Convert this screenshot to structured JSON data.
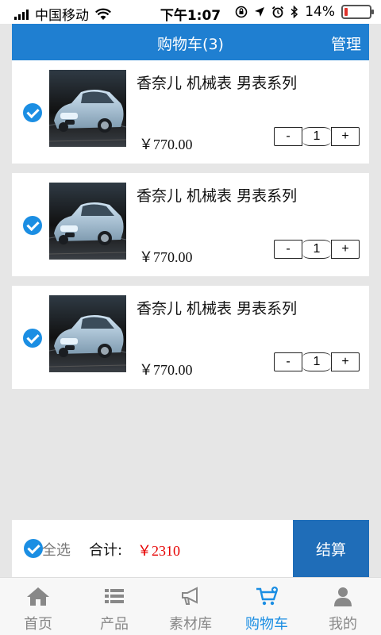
{
  "status_bar": {
    "carrier": "中国移动",
    "time": "下午1:07",
    "battery": "14%",
    "battery_level": 0.14
  },
  "header": {
    "title": "购物车(3)",
    "manage_label": "管理"
  },
  "cart": {
    "items": [
      {
        "name": "香奈儿 机械表 男表系列",
        "price": "￥770.00",
        "quantity": "1",
        "selected": true
      },
      {
        "name": "香奈儿 机械表 男表系列",
        "price": "￥770.00",
        "quantity": "1",
        "selected": true
      },
      {
        "name": "香奈儿 机械表 男表系列",
        "price": "￥770.00",
        "quantity": "1",
        "selected": true
      }
    ],
    "minus_label": "-",
    "plus_label": "+"
  },
  "footer": {
    "select_all_label": "全选",
    "total_label": "合计:",
    "total_value": "￥2310",
    "checkout_label": "结算"
  },
  "tab_bar": {
    "tabs": [
      {
        "label": "首页",
        "icon": "home-icon",
        "active": false
      },
      {
        "label": "产品",
        "icon": "list-icon",
        "active": false
      },
      {
        "label": "素材库",
        "icon": "megaphone-icon",
        "active": false
      },
      {
        "label": "购物车",
        "icon": "cart-icon",
        "active": true
      },
      {
        "label": "我的",
        "icon": "user-icon",
        "active": false
      }
    ]
  },
  "colors": {
    "primary": "#1f7fd1",
    "checkout": "#1f6db8",
    "check": "#1b8ee3",
    "price_total": "#e60000",
    "background": "#e6e6e6"
  }
}
